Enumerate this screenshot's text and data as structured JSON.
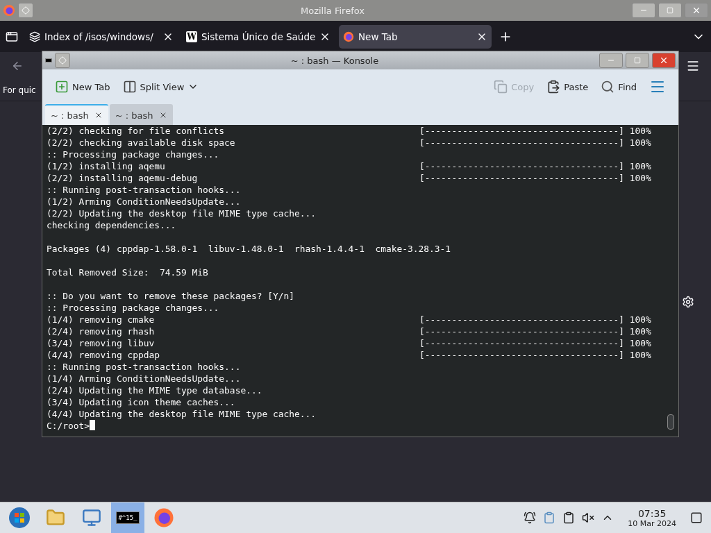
{
  "browser": {
    "title": "Mozilla Firefox",
    "tabs": [
      {
        "label": "Index of /isos/windows/",
        "kind": "stack",
        "selected": false
      },
      {
        "label": "Sistema Único de Saúde",
        "kind": "wiki",
        "icon_text": "W",
        "selected": false
      },
      {
        "label": "New Tab",
        "kind": "firefox",
        "selected": true
      }
    ],
    "bookmark_text": "For quic"
  },
  "konsole": {
    "title": "~ : bash — Konsole",
    "toolbar": [
      {
        "kind": "newtab",
        "label": "New Tab",
        "disabled": false
      },
      {
        "kind": "split",
        "label": "Split View",
        "disabled": false
      },
      {
        "kind": "copy",
        "label": "Copy",
        "disabled": true
      },
      {
        "kind": "paste",
        "label": "Paste",
        "disabled": false
      },
      {
        "kind": "find",
        "label": "Find",
        "disabled": false
      }
    ],
    "tabs": [
      {
        "label": "~ : bash",
        "selected": true
      },
      {
        "label": "~ : bash",
        "selected": false
      }
    ],
    "lines": [
      {
        "kind": "text",
        "text": "(2/2) checking for file conflicts",
        "progress": "[------------------------------------] 100%"
      },
      {
        "kind": "text",
        "text": "(2/2) checking available disk space",
        "progress": "[------------------------------------] 100%"
      },
      {
        "kind": "text",
        "text": ":: Processing package changes..."
      },
      {
        "kind": "text",
        "text": "(1/2) installing aqemu",
        "progress": "[------------------------------------] 100%"
      },
      {
        "kind": "text",
        "text": "(2/2) installing aqemu-debug",
        "progress": "[------------------------------------] 100%"
      },
      {
        "kind": "text",
        "text": ":: Running post-transaction hooks..."
      },
      {
        "kind": "text",
        "text": "(1/2) Arming ConditionNeedsUpdate..."
      },
      {
        "kind": "text",
        "text": "(2/2) Updating the desktop file MIME type cache..."
      },
      {
        "kind": "text",
        "text": "checking dependencies..."
      },
      {
        "kind": "blank"
      },
      {
        "kind": "text",
        "text": "Packages (4) cppdap-1.58.0-1  libuv-1.48.0-1  rhash-1.4.4-1  cmake-3.28.3-1"
      },
      {
        "kind": "blank"
      },
      {
        "kind": "text",
        "text": "Total Removed Size:  74.59 MiB"
      },
      {
        "kind": "blank"
      },
      {
        "kind": "text",
        "text": ":: Do you want to remove these packages? [Y/n]"
      },
      {
        "kind": "text",
        "text": ":: Processing package changes..."
      },
      {
        "kind": "text",
        "text": "(1/4) removing cmake",
        "progress": "[------------------------------------] 100%"
      },
      {
        "kind": "text",
        "text": "(2/4) removing rhash",
        "progress": "[------------------------------------] 100%"
      },
      {
        "kind": "text",
        "text": "(3/4) removing libuv",
        "progress": "[------------------------------------] 100%"
      },
      {
        "kind": "text",
        "text": "(4/4) removing cppdap",
        "progress": "[------------------------------------] 100%"
      },
      {
        "kind": "text",
        "text": ":: Running post-transaction hooks..."
      },
      {
        "kind": "text",
        "text": "(1/4) Arming ConditionNeedsUpdate..."
      },
      {
        "kind": "text",
        "text": "(2/4) Updating the MIME type database..."
      },
      {
        "kind": "text",
        "text": "(3/4) Updating icon theme caches..."
      },
      {
        "kind": "text",
        "text": "(4/4) Updating the desktop file MIME type cache..."
      }
    ],
    "prompt": "C:/root>"
  },
  "taskbar": {
    "apps": [
      {
        "kind": "start",
        "selected": false
      },
      {
        "kind": "files",
        "selected": false
      },
      {
        "kind": "network",
        "selected": false
      },
      {
        "kind": "terminal",
        "icon_text": "#^15_",
        "selected": true
      },
      {
        "kind": "firefox",
        "selected": false
      }
    ],
    "time": "07:35",
    "date": "10 Mar 2024"
  }
}
